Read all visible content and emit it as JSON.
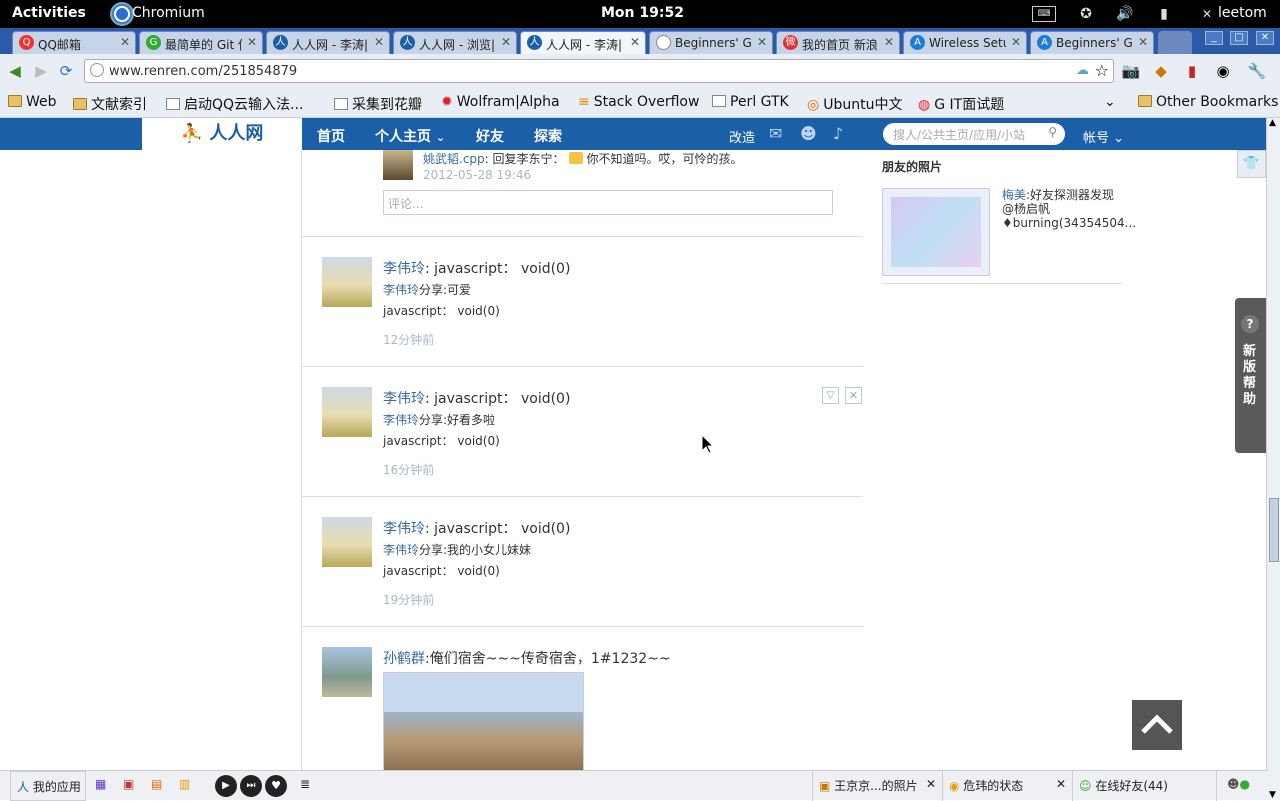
{
  "system_bar": {
    "activities": "Activities",
    "app": "Chromium",
    "clock": "Mon 19:52",
    "user": "leetom"
  },
  "tabs": [
    {
      "label": "QQ邮箱",
      "active": false
    },
    {
      "label": "最简单的 Git 使",
      "active": false
    },
    {
      "label": "人人网 - 李涛|",
      "active": false
    },
    {
      "label": "人人网 - 浏览|",
      "active": false
    },
    {
      "label": "人人网 - 李涛|",
      "active": true
    },
    {
      "label": "Beginners' Gui",
      "active": false
    },
    {
      "label": "我的首页 新浪",
      "active": false
    },
    {
      "label": "Wireless Setup",
      "active": false
    },
    {
      "label": "Beginners' Gui",
      "active": false
    }
  ],
  "toolbar": {
    "url": "www.renren.com/251854879"
  },
  "bookmarks": [
    {
      "label": "Web",
      "icon": "folder-icon"
    },
    {
      "label": "文献索引",
      "icon": "folder-icon"
    },
    {
      "label": "启动QQ云输入法...",
      "icon": "page-icon"
    },
    {
      "label": "采集到花瓣",
      "icon": "page-icon"
    },
    {
      "label": "Wolfram|Alpha",
      "icon": "wolfram-icon"
    },
    {
      "label": "Stack Overflow",
      "icon": "stackoverflow-icon"
    },
    {
      "label": "Perl GTK",
      "icon": "page-icon"
    },
    {
      "label": "Ubuntu中文",
      "icon": "ubuntu-icon"
    },
    {
      "label": "G IT面试题",
      "icon": "weibo-icon"
    },
    {
      "label": "Other Bookmarks",
      "icon": "folder-icon"
    }
  ],
  "renren_nav": {
    "logo": "人人网",
    "items": [
      "首页",
      "个人主页",
      "好友",
      "探索"
    ],
    "right_link": "改造",
    "search_placeholder": "搜人/公共主页/应用/小站",
    "account": "帐号"
  },
  "feed": {
    "comment": {
      "author": "姚武韬.cpp",
      "text": ": 回复李东宁：",
      "text2": "你不知道吗。哎，可怜的孩。",
      "time": "2012-05-28 19:46",
      "input_placeholder": "评论..."
    },
    "items": [
      {
        "author": "李伟玲",
        "title": ": javascript： void(0)",
        "share_text": "分享:可爱",
        "body": "javascript： void(0)",
        "time": "12分钟前"
      },
      {
        "author": "李伟玲",
        "title": ": javascript： void(0)",
        "share_text": "分享:好看多啦",
        "body": "javascript： void(0)",
        "time": "16分钟前"
      },
      {
        "author": "李伟玲",
        "title": ": javascript： void(0)",
        "share_text": "分享:我的小女儿妹妹",
        "body": "javascript： void(0)",
        "time": "19分钟前"
      },
      {
        "author": "孙鹤群",
        "title": ":俺们宿舍~~~传奇宿舍，1#1232~~"
      }
    ]
  },
  "right": {
    "heading": "朋友的照片",
    "photo_author": "梅美",
    "photo_text": ":好友探测器发现@杨启帆♦burning(34354504..."
  },
  "help_tab": {
    "label": "新版帮助"
  },
  "bottom_bar": {
    "my_apps": "我的应用",
    "task1": "王京京...的照片",
    "task2": "危玮的状态",
    "online": "在线好友(44)"
  }
}
